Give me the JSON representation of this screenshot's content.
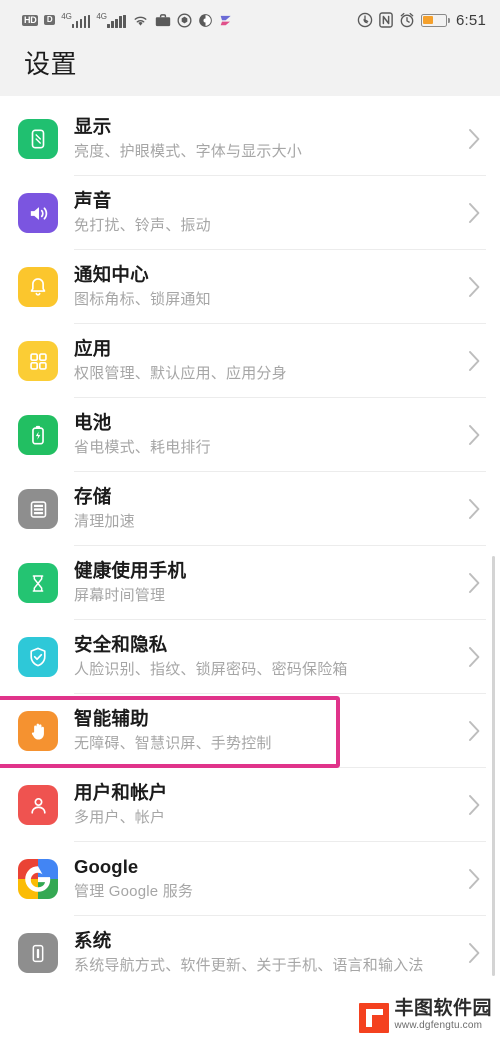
{
  "status_bar": {
    "hd_label": "HD",
    "dual_sim_label": "D",
    "network_type_1": "4G",
    "network_type_2": "4G",
    "icons_left": [
      "hd-voice-icon",
      "dual-sim-icon",
      "signal-4g-icon-1",
      "signal-4g-icon-2",
      "wifi-icon",
      "briefcase-icon",
      "shield-icon",
      "eye-comfort-icon",
      "send-arrow-icon"
    ],
    "icons_right": [
      "data-saver-icon",
      "nfc-icon",
      "alarm-icon",
      "battery-icon"
    ],
    "nfc_label": "N",
    "battery_percent": 45,
    "clock": "6:51"
  },
  "header": {
    "title": "设置"
  },
  "settings_list": [
    {
      "title": "显示",
      "subtitle": "亮度、护眼模式、字体与显示大小",
      "icon": "display-icon",
      "icon_color": "#20c070",
      "name": "display",
      "highlighted": false,
      "latin": false
    },
    {
      "title": "声音",
      "subtitle": "免打扰、铃声、振动",
      "icon": "sound-icon",
      "icon_color": "#7b55e0",
      "name": "sound",
      "highlighted": false,
      "latin": false
    },
    {
      "title": "通知中心",
      "subtitle": "图标角标、锁屏通知",
      "icon": "notification-bell-icon",
      "icon_color": "#fbc62d",
      "name": "notification-center",
      "highlighted": false,
      "latin": false
    },
    {
      "title": "应用",
      "subtitle": "权限管理、默认应用、应用分身",
      "icon": "apps-grid-icon",
      "icon_color": "#fbcd35",
      "name": "apps",
      "highlighted": false,
      "latin": false
    },
    {
      "title": "电池",
      "subtitle": "省电模式、耗电排行",
      "icon": "battery-charging-icon",
      "icon_color": "#22bf62",
      "name": "battery",
      "highlighted": false,
      "latin": false
    },
    {
      "title": "存储",
      "subtitle": "清理加速",
      "icon": "storage-icon",
      "icon_color": "#8e8e8e",
      "name": "storage",
      "highlighted": false,
      "latin": false
    },
    {
      "title": "健康使用手机",
      "subtitle": "屏幕时间管理",
      "icon": "hourglass-icon",
      "icon_color": "#24c472",
      "name": "digital-balance",
      "highlighted": false,
      "latin": false
    },
    {
      "title": "安全和隐私",
      "subtitle": "人脸识别、指纹、锁屏密码、密码保险箱",
      "icon": "shield-check-icon",
      "icon_color": "#2ec8d8",
      "name": "security-privacy",
      "highlighted": false,
      "latin": false
    },
    {
      "title": "智能辅助",
      "subtitle": "无障碍、智慧识屏、手势控制",
      "icon": "hand-icon",
      "icon_color": "#f59230",
      "name": "smart-assistance",
      "highlighted": true,
      "latin": false
    },
    {
      "title": "用户和帐户",
      "subtitle": "多用户、帐户",
      "icon": "user-account-icon",
      "icon_color": "#ef5350",
      "name": "users-accounts",
      "highlighted": false,
      "latin": false
    },
    {
      "title": "Google",
      "subtitle": "管理 Google 服务",
      "icon": "google-g-icon",
      "icon_color": "#ffffff",
      "name": "google",
      "highlighted": false,
      "latin": true
    },
    {
      "title": "系统",
      "subtitle": "系统导航方式、软件更新、关于手机、语言和输入法",
      "icon": "system-phone-icon",
      "icon_color": "#8e8e8e",
      "name": "system",
      "highlighted": false,
      "latin": false
    }
  ],
  "highlight": {
    "color": "#e0338a",
    "target": "智能辅助"
  },
  "watermark": {
    "name": "丰图软件园",
    "url": "www.dgfengtu.com"
  }
}
